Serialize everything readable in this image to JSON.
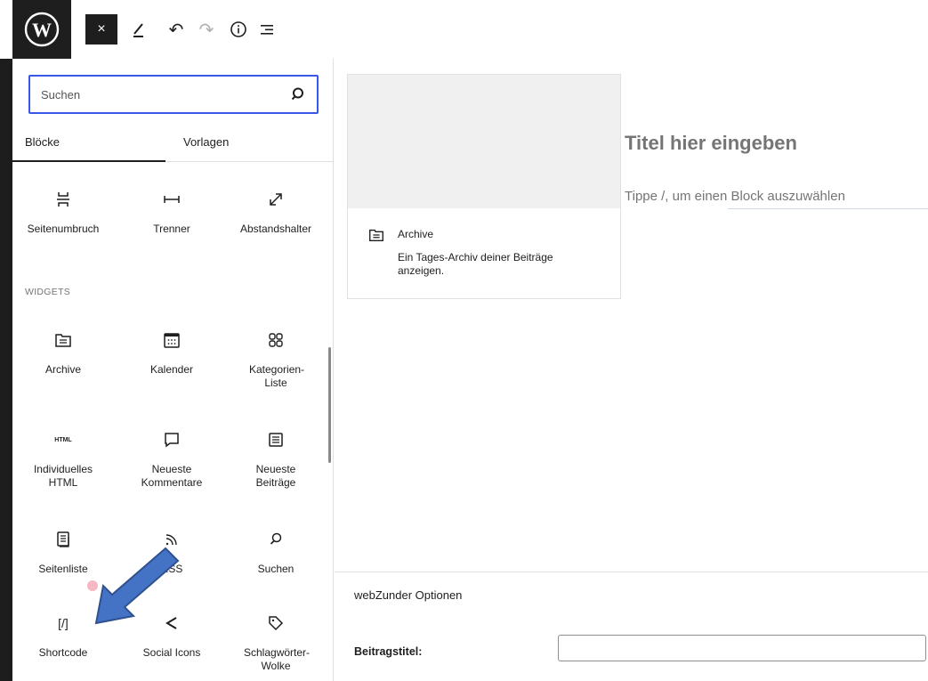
{
  "toolbar": {
    "logo_icon": "wordpress-logo",
    "close_glyph": "×",
    "pen_icon": "pen-icon",
    "undo_glyph": "↶",
    "redo_glyph": "↷",
    "info_icon": "info-icon",
    "list_icon": "list-view-icon"
  },
  "inserter": {
    "search": {
      "placeholder": "Suchen",
      "value": ""
    },
    "tabs": [
      {
        "label": "Blöcke",
        "active": true
      },
      {
        "label": "Vorlagen",
        "active": false
      }
    ],
    "design_blocks": [
      {
        "label": "Seitenumbruch",
        "icon": "page-break-icon"
      },
      {
        "label": "Trenner",
        "icon": "separator-icon"
      },
      {
        "label": "Abstandshalter",
        "icon": "spacer-icon"
      }
    ],
    "widgets_title": "WIDGETS",
    "widgets": [
      {
        "label": "Archive",
        "icon": "archive-icon"
      },
      {
        "label": "Kalender",
        "icon": "calendar-icon"
      },
      {
        "label": "Kategorien-Liste",
        "icon": "categories-icon"
      },
      {
        "label": "Individuelles HTML",
        "icon": "html-icon",
        "glyph": "HTML"
      },
      {
        "label": "Neueste Kommentare",
        "icon": "comment-icon"
      },
      {
        "label": "Neueste Beiträge",
        "icon": "posts-list-icon"
      },
      {
        "label": "Seitenliste",
        "icon": "page-list-icon"
      },
      {
        "label": "RSS",
        "icon": "rss-icon"
      },
      {
        "label": "Suchen",
        "icon": "search-icon"
      },
      {
        "label": "Shortcode",
        "icon": "shortcode-icon",
        "glyph": "[/]"
      },
      {
        "label": "Social Icons",
        "icon": "share-icon"
      },
      {
        "label": "Schlagwörter-Wolke",
        "icon": "tag-icon"
      }
    ]
  },
  "preview": {
    "title": "Archive",
    "description": "Ein Tages-Archiv deiner Beiträge anzeigen."
  },
  "editor": {
    "title_placeholder": "Titel hier eingeben",
    "block_placeholder": "Tippe /, um einen Block auszuwählen"
  },
  "metabox": {
    "title": "webZunder Optionen",
    "field_label": "Beitragstitel:",
    "field_value": ""
  },
  "colors": {
    "accent": "#3858e9",
    "annotation_arrow": "#4472c4"
  }
}
